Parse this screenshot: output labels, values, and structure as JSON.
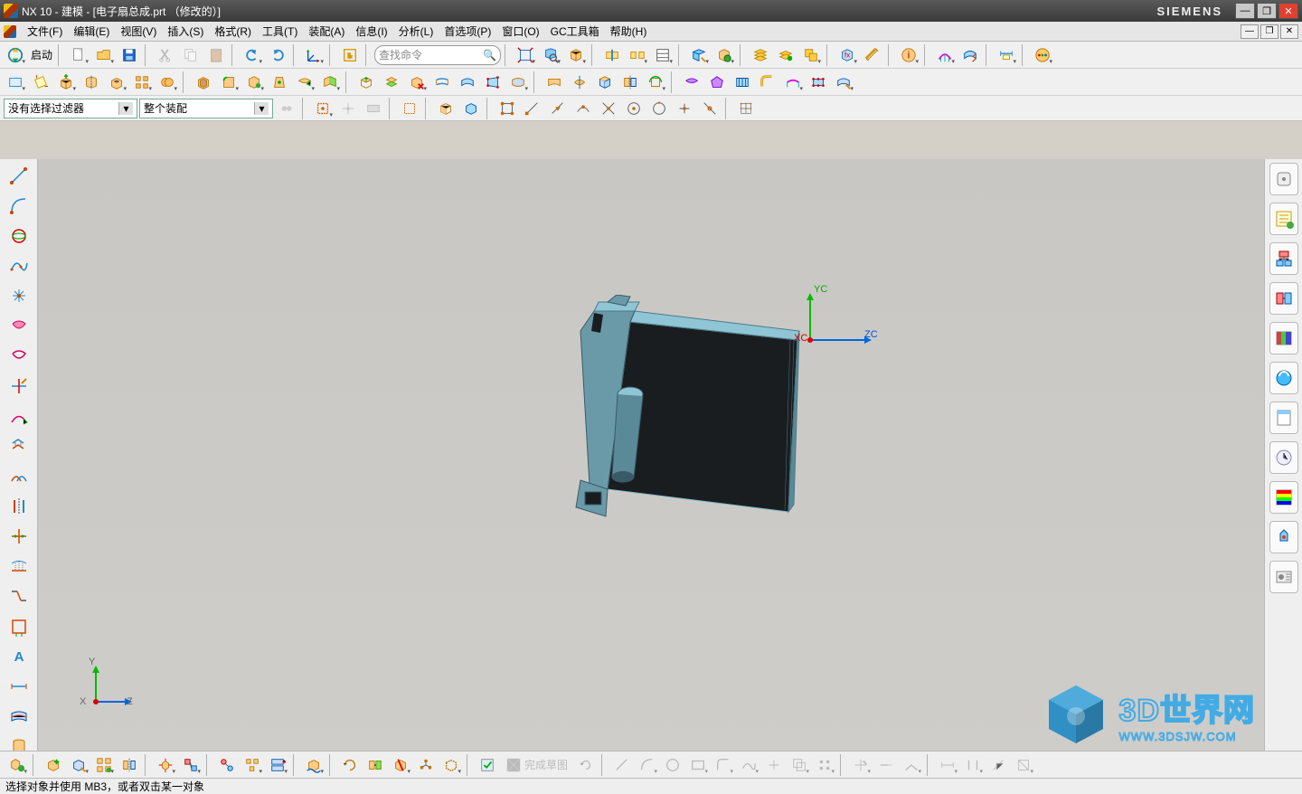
{
  "title": "NX 10 - 建模 - [电子扇总成.prt （修改的）]",
  "brand": "SIEMENS",
  "menu": [
    "文件(F)",
    "编辑(E)",
    "视图(V)",
    "插入(S)",
    "格式(R)",
    "工具(T)",
    "装配(A)",
    "信息(I)",
    "分析(L)",
    "首选项(P)",
    "窗口(O)",
    "GC工具箱",
    "帮助(H)"
  ],
  "start_button": "启动",
  "search_placeholder": "查找命令",
  "filter_combo": "没有选择过滤器",
  "scope_combo": "整个装配",
  "finish_sketch": "完成草图",
  "status_message": "选择对象并使用 MB3，或者双击某一对象",
  "csys": {
    "x": "XC",
    "y": "YC",
    "z": "ZC"
  },
  "triad": {
    "x": "X",
    "y": "Y",
    "z": "Z"
  },
  "watermark": {
    "title": "3D世界网",
    "url": "WWW.3DSJW.COM"
  }
}
